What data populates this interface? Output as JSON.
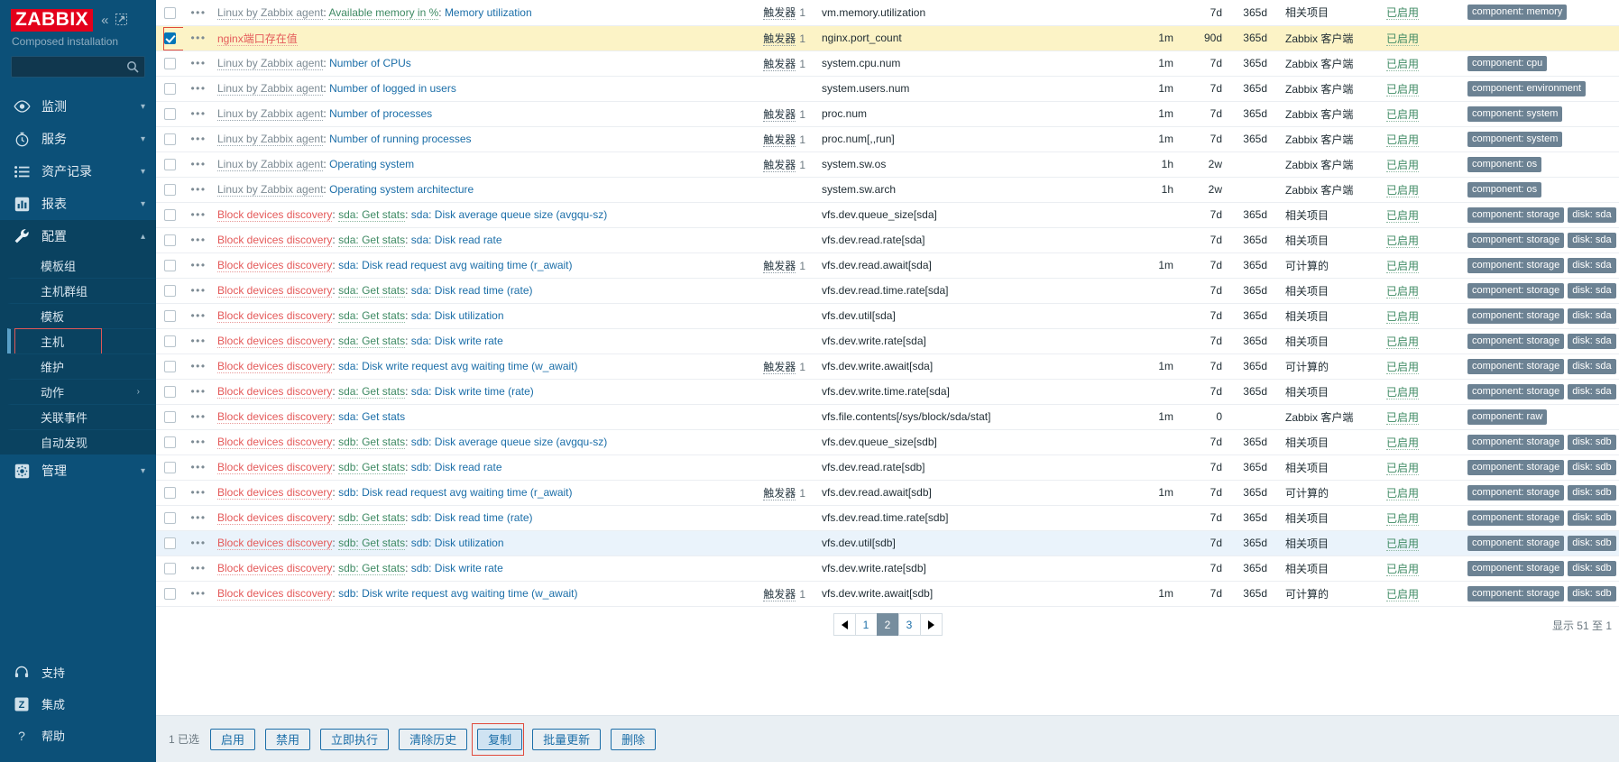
{
  "sidebar": {
    "logo": "ZABBIX",
    "collapse_icon": "double-chevron-left-icon",
    "hide_icon": "collapse-panel-icon",
    "subtitle": "Composed installation",
    "search_placeholder": "",
    "search_value": "",
    "search_icon": "search-icon",
    "items": [
      {
        "label": "监测",
        "icon": "eye-icon",
        "chev": "chevron-down"
      },
      {
        "label": "服务",
        "icon": "stopwatch-icon",
        "chev": "chevron-down"
      },
      {
        "label": "资产记录",
        "icon": "list-icon",
        "chev": "chevron-down"
      },
      {
        "label": "报表",
        "icon": "bar-chart-icon",
        "chev": "chevron-down"
      },
      {
        "label": "配置",
        "icon": "wrench-icon",
        "chev": "chevron-up"
      }
    ],
    "config_subitems": [
      {
        "label": "模板组"
      },
      {
        "label": "主机群组"
      },
      {
        "label": "模板"
      },
      {
        "label": "主机",
        "selected": true,
        "highlighted": true
      },
      {
        "label": "维护"
      },
      {
        "label": "动作",
        "arrow": "›"
      },
      {
        "label": "关联事件"
      },
      {
        "label": "自动发现"
      }
    ],
    "admin": {
      "label": "管理",
      "icon": "gear-icon",
      "chev": "chevron-down"
    },
    "bottom_items": [
      {
        "label": "支持",
        "icon": "headset-icon"
      },
      {
        "label": "集成",
        "icon": "zabbix-z-icon"
      },
      {
        "label": "帮助",
        "icon": "question-icon"
      }
    ]
  },
  "table": {
    "rows": [
      {
        "checked": false,
        "prefixes": [
          {
            "text": "Linux by Zabbix agent",
            "style": "gray"
          },
          {
            "text": "Available memory in %",
            "style": "green"
          }
        ],
        "name": "Memory utilization",
        "triggers": "触发器",
        "trigger_count": "1",
        "key": "vm.memory.utilization",
        "interval": "",
        "history": "7d",
        "trends": "365d",
        "type": "相关项目",
        "status": "已启用",
        "tags": [
          "component: memory"
        ]
      },
      {
        "checked": true,
        "selected": true,
        "prefixes": [],
        "name": "nginx端口存在值",
        "name_style": "red",
        "triggers": "触发器",
        "trigger_count": "1",
        "key": "nginx.port_count",
        "interval": "1m",
        "history": "90d",
        "trends": "365d",
        "type": "Zabbix 客户端",
        "status": "已启用",
        "tags": []
      },
      {
        "checked": false,
        "prefixes": [
          {
            "text": "Linux by Zabbix agent",
            "style": "gray"
          }
        ],
        "name": "Number of CPUs",
        "triggers": "触发器",
        "trigger_count": "1",
        "key": "system.cpu.num",
        "interval": "1m",
        "history": "7d",
        "trends": "365d",
        "type": "Zabbix 客户端",
        "status": "已启用",
        "tags": [
          "component: cpu"
        ]
      },
      {
        "checked": false,
        "prefixes": [
          {
            "text": "Linux by Zabbix agent",
            "style": "gray"
          }
        ],
        "name": "Number of logged in users",
        "triggers": "",
        "trigger_count": "",
        "key": "system.users.num",
        "interval": "1m",
        "history": "7d",
        "trends": "365d",
        "type": "Zabbix 客户端",
        "status": "已启用",
        "tags": [
          "component: environment"
        ]
      },
      {
        "checked": false,
        "prefixes": [
          {
            "text": "Linux by Zabbix agent",
            "style": "gray"
          }
        ],
        "name": "Number of processes",
        "triggers": "触发器",
        "trigger_count": "1",
        "key": "proc.num",
        "interval": "1m",
        "history": "7d",
        "trends": "365d",
        "type": "Zabbix 客户端",
        "status": "已启用",
        "tags": [
          "component: system"
        ]
      },
      {
        "checked": false,
        "prefixes": [
          {
            "text": "Linux by Zabbix agent",
            "style": "gray"
          }
        ],
        "name": "Number of running processes",
        "triggers": "触发器",
        "trigger_count": "1",
        "key": "proc.num[,,run]",
        "interval": "1m",
        "history": "7d",
        "trends": "365d",
        "type": "Zabbix 客户端",
        "status": "已启用",
        "tags": [
          "component: system"
        ]
      },
      {
        "checked": false,
        "prefixes": [
          {
            "text": "Linux by Zabbix agent",
            "style": "gray"
          }
        ],
        "name": "Operating system",
        "triggers": "触发器",
        "trigger_count": "1",
        "key": "system.sw.os",
        "interval": "1h",
        "history": "2w",
        "trends": "",
        "type": "Zabbix 客户端",
        "status": "已启用",
        "tags": [
          "component: os"
        ]
      },
      {
        "checked": false,
        "prefixes": [
          {
            "text": "Linux by Zabbix agent",
            "style": "gray"
          }
        ],
        "name": "Operating system architecture",
        "triggers": "",
        "trigger_count": "",
        "key": "system.sw.arch",
        "interval": "1h",
        "history": "2w",
        "trends": "",
        "type": "Zabbix 客户端",
        "status": "已启用",
        "tags": [
          "component: os"
        ]
      },
      {
        "checked": false,
        "prefixes": [
          {
            "text": "Block devices discovery",
            "style": "red"
          },
          {
            "text": "sda: Get stats",
            "style": "green"
          }
        ],
        "name": "sda: Disk average queue size (avgqu-sz)",
        "triggers": "",
        "trigger_count": "",
        "key": "vfs.dev.queue_size[sda]",
        "interval": "",
        "history": "7d",
        "trends": "365d",
        "type": "相关项目",
        "status": "已启用",
        "tags": [
          "component: storage",
          "disk: sda"
        ]
      },
      {
        "checked": false,
        "prefixes": [
          {
            "text": "Block devices discovery",
            "style": "red"
          },
          {
            "text": "sda: Get stats",
            "style": "green"
          }
        ],
        "name": "sda: Disk read rate",
        "triggers": "",
        "trigger_count": "",
        "key": "vfs.dev.read.rate[sda]",
        "interval": "",
        "history": "7d",
        "trends": "365d",
        "type": "相关项目",
        "status": "已启用",
        "tags": [
          "component: storage",
          "disk: sda"
        ]
      },
      {
        "checked": false,
        "prefixes": [
          {
            "text": "Block devices discovery",
            "style": "red"
          }
        ],
        "name": "sda: Disk read request avg waiting time (r_await)",
        "triggers": "触发器",
        "trigger_count": "1",
        "key": "vfs.dev.read.await[sda]",
        "interval": "1m",
        "history": "7d",
        "trends": "365d",
        "type": "可计算的",
        "status": "已启用",
        "tags": [
          "component: storage",
          "disk: sda"
        ]
      },
      {
        "checked": false,
        "prefixes": [
          {
            "text": "Block devices discovery",
            "style": "red"
          },
          {
            "text": "sda: Get stats",
            "style": "green"
          }
        ],
        "name": "sda: Disk read time (rate)",
        "triggers": "",
        "trigger_count": "",
        "key": "vfs.dev.read.time.rate[sda]",
        "interval": "",
        "history": "7d",
        "trends": "365d",
        "type": "相关项目",
        "status": "已启用",
        "tags": [
          "component: storage",
          "disk: sda"
        ]
      },
      {
        "checked": false,
        "prefixes": [
          {
            "text": "Block devices discovery",
            "style": "red"
          },
          {
            "text": "sda: Get stats",
            "style": "green"
          }
        ],
        "name": "sda: Disk utilization",
        "triggers": "",
        "trigger_count": "",
        "key": "vfs.dev.util[sda]",
        "interval": "",
        "history": "7d",
        "trends": "365d",
        "type": "相关项目",
        "status": "已启用",
        "tags": [
          "component: storage",
          "disk: sda"
        ]
      },
      {
        "checked": false,
        "prefixes": [
          {
            "text": "Block devices discovery",
            "style": "red"
          },
          {
            "text": "sda: Get stats",
            "style": "green"
          }
        ],
        "name": "sda: Disk write rate",
        "triggers": "",
        "trigger_count": "",
        "key": "vfs.dev.write.rate[sda]",
        "interval": "",
        "history": "7d",
        "trends": "365d",
        "type": "相关项目",
        "status": "已启用",
        "tags": [
          "component: storage",
          "disk: sda"
        ]
      },
      {
        "checked": false,
        "prefixes": [
          {
            "text": "Block devices discovery",
            "style": "red"
          }
        ],
        "name": "sda: Disk write request avg waiting time (w_await)",
        "triggers": "触发器",
        "trigger_count": "1",
        "key": "vfs.dev.write.await[sda]",
        "interval": "1m",
        "history": "7d",
        "trends": "365d",
        "type": "可计算的",
        "status": "已启用",
        "tags": [
          "component: storage",
          "disk: sda"
        ]
      },
      {
        "checked": false,
        "prefixes": [
          {
            "text": "Block devices discovery",
            "style": "red"
          },
          {
            "text": "sda: Get stats",
            "style": "green"
          }
        ],
        "name": "sda: Disk write time (rate)",
        "triggers": "",
        "trigger_count": "",
        "key": "vfs.dev.write.time.rate[sda]",
        "interval": "",
        "history": "7d",
        "trends": "365d",
        "type": "相关项目",
        "status": "已启用",
        "tags": [
          "component: storage",
          "disk: sda"
        ]
      },
      {
        "checked": false,
        "prefixes": [
          {
            "text": "Block devices discovery",
            "style": "red"
          }
        ],
        "name": "sda: Get stats",
        "triggers": "",
        "trigger_count": "",
        "key": "vfs.file.contents[/sys/block/sda/stat]",
        "interval": "1m",
        "history": "0",
        "trends": "",
        "type": "Zabbix 客户端",
        "status": "已启用",
        "tags": [
          "component: raw"
        ]
      },
      {
        "checked": false,
        "prefixes": [
          {
            "text": "Block devices discovery",
            "style": "red"
          },
          {
            "text": "sdb: Get stats",
            "style": "green"
          }
        ],
        "name": "sdb: Disk average queue size (avgqu-sz)",
        "triggers": "",
        "trigger_count": "",
        "key": "vfs.dev.queue_size[sdb]",
        "interval": "",
        "history": "7d",
        "trends": "365d",
        "type": "相关项目",
        "status": "已启用",
        "tags": [
          "component: storage",
          "disk: sdb"
        ]
      },
      {
        "checked": false,
        "prefixes": [
          {
            "text": "Block devices discovery",
            "style": "red"
          },
          {
            "text": "sdb: Get stats",
            "style": "green"
          }
        ],
        "name": "sdb: Disk read rate",
        "triggers": "",
        "trigger_count": "",
        "key": "vfs.dev.read.rate[sdb]",
        "interval": "",
        "history": "7d",
        "trends": "365d",
        "type": "相关项目",
        "status": "已启用",
        "tags": [
          "component: storage",
          "disk: sdb"
        ]
      },
      {
        "checked": false,
        "prefixes": [
          {
            "text": "Block devices discovery",
            "style": "red"
          }
        ],
        "name": "sdb: Disk read request avg waiting time (r_await)",
        "triggers": "触发器",
        "trigger_count": "1",
        "key": "vfs.dev.read.await[sdb]",
        "interval": "1m",
        "history": "7d",
        "trends": "365d",
        "type": "可计算的",
        "status": "已启用",
        "tags": [
          "component: storage",
          "disk: sdb"
        ]
      },
      {
        "checked": false,
        "prefixes": [
          {
            "text": "Block devices discovery",
            "style": "red"
          },
          {
            "text": "sdb: Get stats",
            "style": "green"
          }
        ],
        "name": "sdb: Disk read time (rate)",
        "triggers": "",
        "trigger_count": "",
        "key": "vfs.dev.read.time.rate[sdb]",
        "interval": "",
        "history": "7d",
        "trends": "365d",
        "type": "相关项目",
        "status": "已启用",
        "tags": [
          "component: storage",
          "disk: sdb"
        ]
      },
      {
        "checked": false,
        "hovered": true,
        "prefixes": [
          {
            "text": "Block devices discovery",
            "style": "red"
          },
          {
            "text": "sdb: Get stats",
            "style": "green"
          }
        ],
        "name": "sdb: Disk utilization",
        "triggers": "",
        "trigger_count": "",
        "key": "vfs.dev.util[sdb]",
        "interval": "",
        "history": "7d",
        "trends": "365d",
        "type": "相关项目",
        "status": "已启用",
        "tags": [
          "component: storage",
          "disk: sdb"
        ]
      },
      {
        "checked": false,
        "prefixes": [
          {
            "text": "Block devices discovery",
            "style": "red"
          },
          {
            "text": "sdb: Get stats",
            "style": "green"
          }
        ],
        "name": "sdb: Disk write rate",
        "triggers": "",
        "trigger_count": "",
        "key": "vfs.dev.write.rate[sdb]",
        "interval": "",
        "history": "7d",
        "trends": "365d",
        "type": "相关项目",
        "status": "已启用",
        "tags": [
          "component: storage",
          "disk: sdb"
        ]
      },
      {
        "checked": false,
        "prefixes": [
          {
            "text": "Block devices discovery",
            "style": "red"
          }
        ],
        "name": "sdb: Disk write request avg waiting time (w_await)",
        "triggers": "触发器",
        "trigger_count": "1",
        "key": "vfs.dev.write.await[sdb]",
        "interval": "1m",
        "history": "7d",
        "trends": "365d",
        "type": "可计算的",
        "status": "已启用",
        "tags": [
          "component: storage",
          "disk: sdb"
        ]
      }
    ]
  },
  "pager": {
    "prev_icon": "triangle-left-icon",
    "next_icon": "triangle-right-icon",
    "pages": [
      "1",
      "2",
      "3"
    ],
    "current": "2",
    "rowcount": "显示 51 至 1"
  },
  "footer": {
    "selected_text": "1 已选",
    "buttons": [
      {
        "label": "启用"
      },
      {
        "label": "禁用"
      },
      {
        "label": "立即执行"
      },
      {
        "label": "清除历史"
      },
      {
        "label": "复制",
        "highlighted": true
      },
      {
        "label": "批量更新"
      },
      {
        "label": "删除"
      }
    ]
  },
  "colors": {
    "sidebar_bg": "#0c5078",
    "logo_red": "#e3001b",
    "accent_blue": "#1b6ea8",
    "selected_row": "#fcf3c6",
    "hover_row": "#eaf3fb",
    "highlight_outline": "#e04a3c",
    "tag_bg": "#6c8293",
    "enabled_green": "#3e8a63"
  }
}
